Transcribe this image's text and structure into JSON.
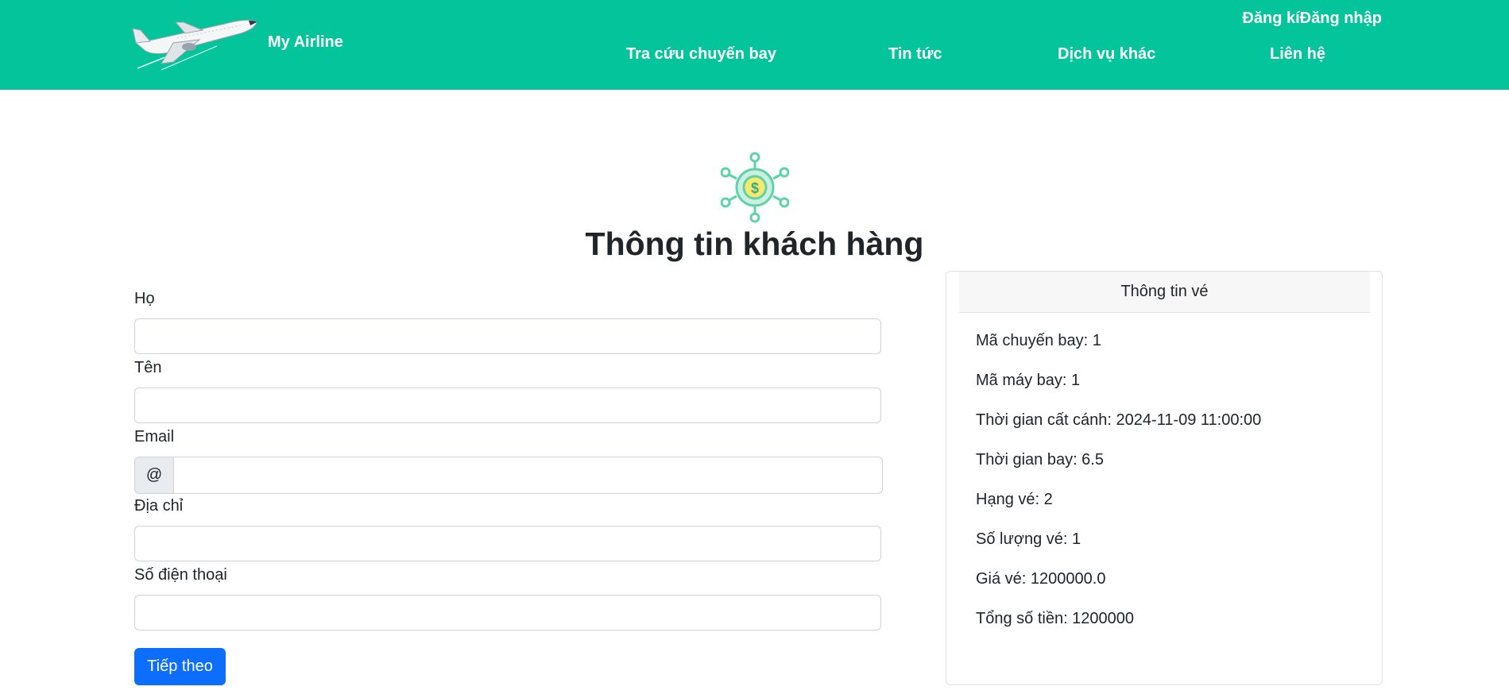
{
  "header": {
    "brand": "My Airline",
    "auth_text": "Đăng kíĐăng nhập",
    "nav": [
      "Tra cứu chuyến bay",
      "Tin tức",
      "Dịch vụ khác",
      "Liên hệ"
    ]
  },
  "main": {
    "title": "Thông tin khách hàng",
    "form": {
      "fields": [
        "Họ",
        "Tên",
        "Email",
        "Địa chỉ",
        "Số điện thoại"
      ],
      "email_prefix": "@",
      "submit_label": "Tiếp theo"
    }
  },
  "ticket": {
    "header": "Thông tin vé",
    "lines": [
      "Mã chuyến bay: 1",
      "Mã máy bay: 1",
      "Thời gian cất cánh: 2024-11-09 11:00:00",
      "Thời gian bay: 6.5",
      "Hạng vé: 2",
      "Số lượng vé: 1",
      "Giá vé: 1200000.0",
      "Tổng số tiền: 1200000"
    ]
  },
  "colors": {
    "navbar": "#04c49c",
    "primary_button": "#0d6efd",
    "icon_ring": "#5fd3a8",
    "icon_coin": "#f7e96a"
  },
  "icons": [
    "airplane-logo",
    "money-network-icon"
  ]
}
